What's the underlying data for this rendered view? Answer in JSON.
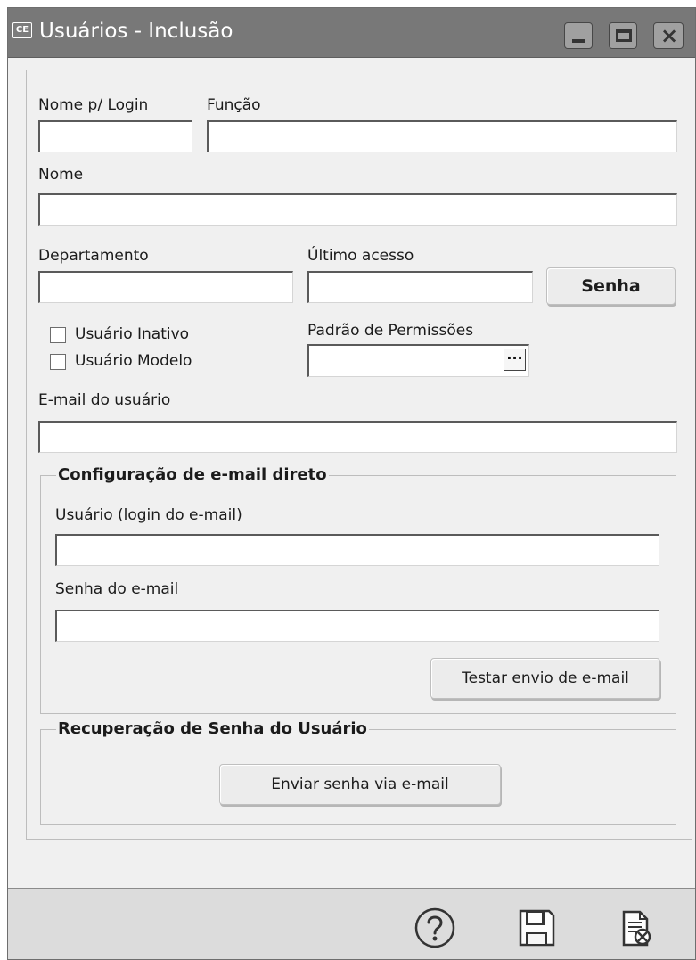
{
  "window": {
    "icon_text": "CE",
    "title": "Usuários - Inclusão"
  },
  "form": {
    "nome_login_label": "Nome p/ Login",
    "nome_login_value": "",
    "funcao_label": "Função",
    "funcao_value": "",
    "nome_label": "Nome",
    "nome_value": "",
    "departamento_label": "Departamento",
    "departamento_value": "",
    "ultimo_acesso_label": "Último acesso",
    "ultimo_acesso_value": "",
    "senha_button": "Senha",
    "usuario_inativo": "Usuário Inativo",
    "usuario_modelo": "Usuário Modelo",
    "padrao_permissoes_label": "Padrão de Permissões",
    "padrao_permissoes_value": "",
    "lookup_button": "...",
    "email_usuario_label": "E-mail do usuário",
    "email_usuario_value": ""
  },
  "email_config": {
    "group_title": "Configuração de e-mail direto",
    "usuario_login_label": "Usuário (login do e-mail)",
    "usuario_login_value": "",
    "senha_email_label": "Senha do e-mail",
    "senha_email_value": "",
    "test_button": "Testar envio de e-mail"
  },
  "recovery": {
    "group_title": "Recuperação de Senha do Usuário",
    "send_button": "Enviar senha via e-mail"
  },
  "toolbar": {
    "help_icon": "help-icon",
    "save_icon": "save-icon",
    "cancel_icon": "cancel-document-icon"
  },
  "colors": {
    "titlebar": "#787878",
    "window_background": "#f0f0f0",
    "statusbar": "#dcdcdc"
  }
}
